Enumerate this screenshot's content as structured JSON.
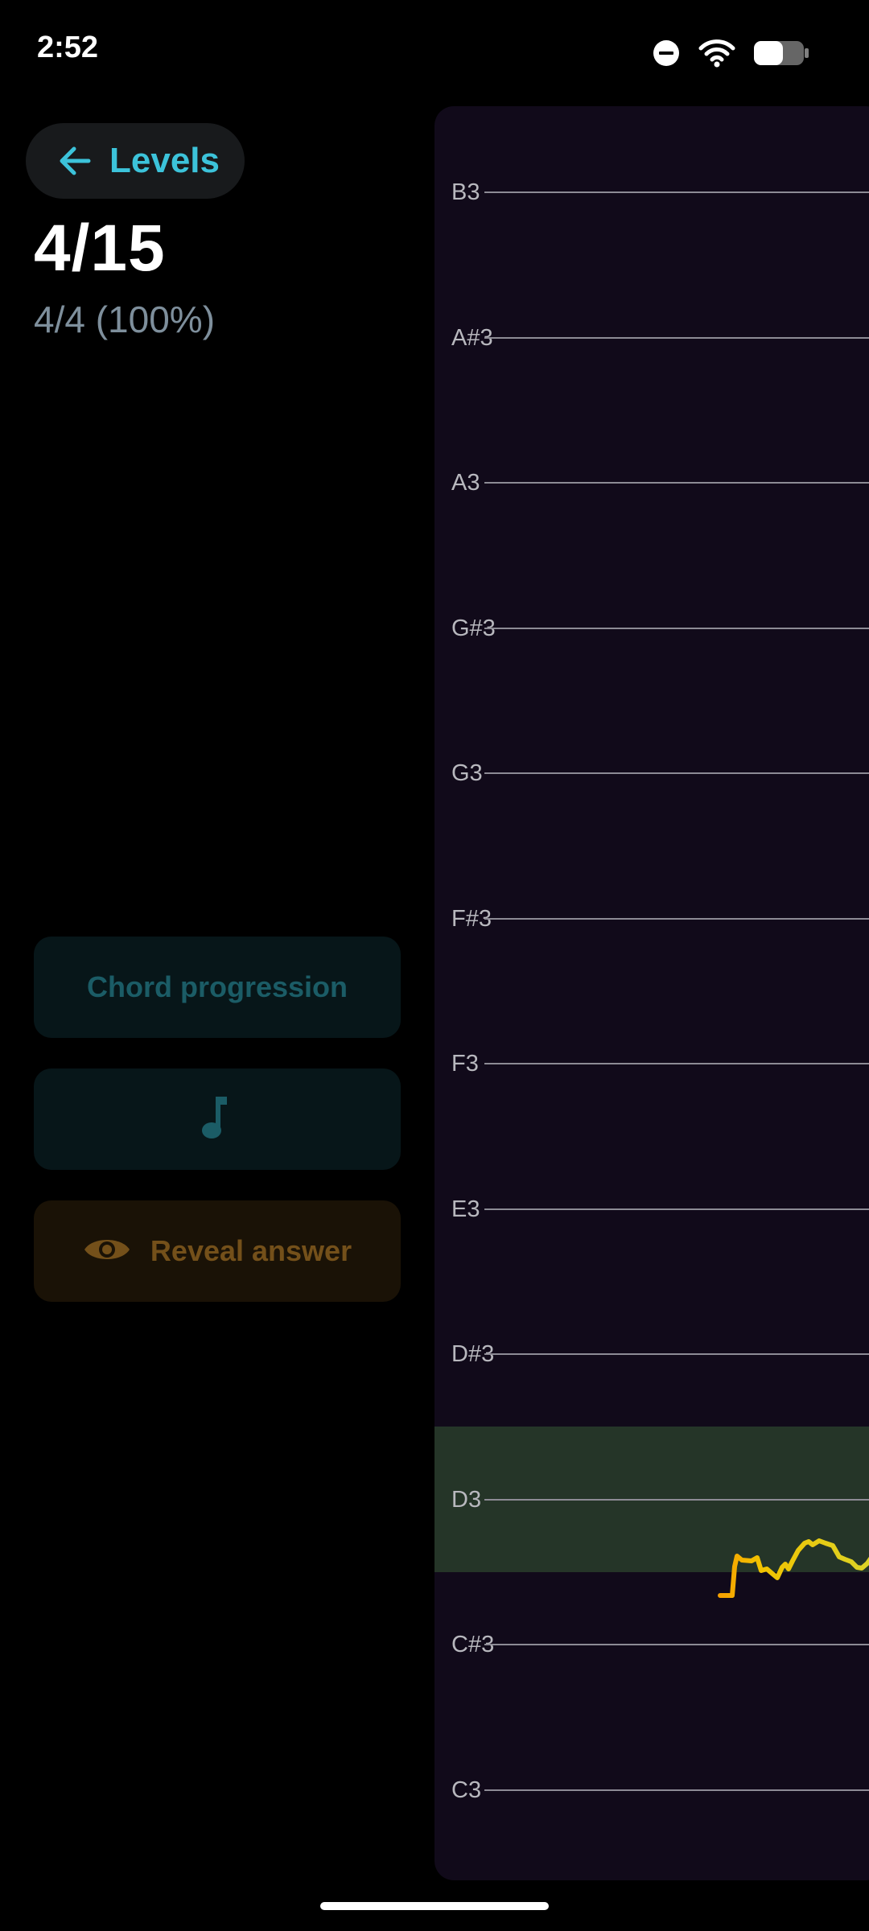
{
  "status_bar": {
    "time": "2:52",
    "icons": [
      "do-not-disturb-icon",
      "wifi-icon",
      "battery-icon"
    ]
  },
  "header": {
    "back_label": "Levels",
    "level_counter": "4/15",
    "score": "4/4 (100%)"
  },
  "actions": {
    "chord_progression_label": "Chord progression",
    "note_button_icon": "music-note-icon",
    "reveal_label": "Reveal answer",
    "reveal_icon": "eye-icon"
  },
  "pitch_panel": {
    "notes": [
      "B3",
      "A#3",
      "A3",
      "G#3",
      "G3",
      "F#3",
      "F3",
      "E3",
      "D#3",
      "D3",
      "C#3",
      "C3"
    ],
    "highlighted_note": "D3"
  },
  "colors": {
    "accent": "#3cc3da",
    "panel_background": "#110a1a",
    "highlight": "#253528",
    "reveal": "#74501a",
    "trace_start": "#f5a000",
    "trace_end": "#e0d22a"
  }
}
